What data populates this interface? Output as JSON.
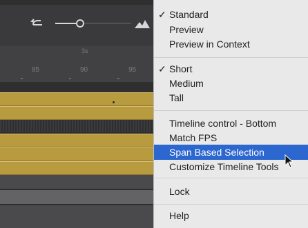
{
  "ruler": {
    "seconds_label": "3s",
    "frames": [
      "85",
      "90",
      "95"
    ]
  },
  "menu": {
    "groups": [
      [
        {
          "label": "Standard",
          "checked": true
        },
        {
          "label": "Preview",
          "checked": false
        },
        {
          "label": "Preview in Context",
          "checked": false
        }
      ],
      [
        {
          "label": "Short",
          "checked": true
        },
        {
          "label": "Medium",
          "checked": false
        },
        {
          "label": "Tall",
          "checked": false
        }
      ],
      [
        {
          "label": "Timeline control - Bottom",
          "checked": false
        },
        {
          "label": "Match FPS",
          "checked": false
        },
        {
          "label": "Span Based Selection",
          "checked": false,
          "highlighted": true
        },
        {
          "label": "Customize Timeline Tools",
          "checked": false
        }
      ],
      [
        {
          "label": "Lock",
          "checked": false
        }
      ],
      [
        {
          "label": "Help",
          "checked": false
        }
      ]
    ],
    "check_glyph": "✓"
  },
  "colors": {
    "highlight": "#2c66cf",
    "keyframe_layer": "#b89b3f",
    "menu_bg": "#e9e9ea"
  },
  "icons": [
    "loop-icon",
    "zoom-slider-icon",
    "mountain-icon",
    "mouse-pointer-icon"
  ]
}
